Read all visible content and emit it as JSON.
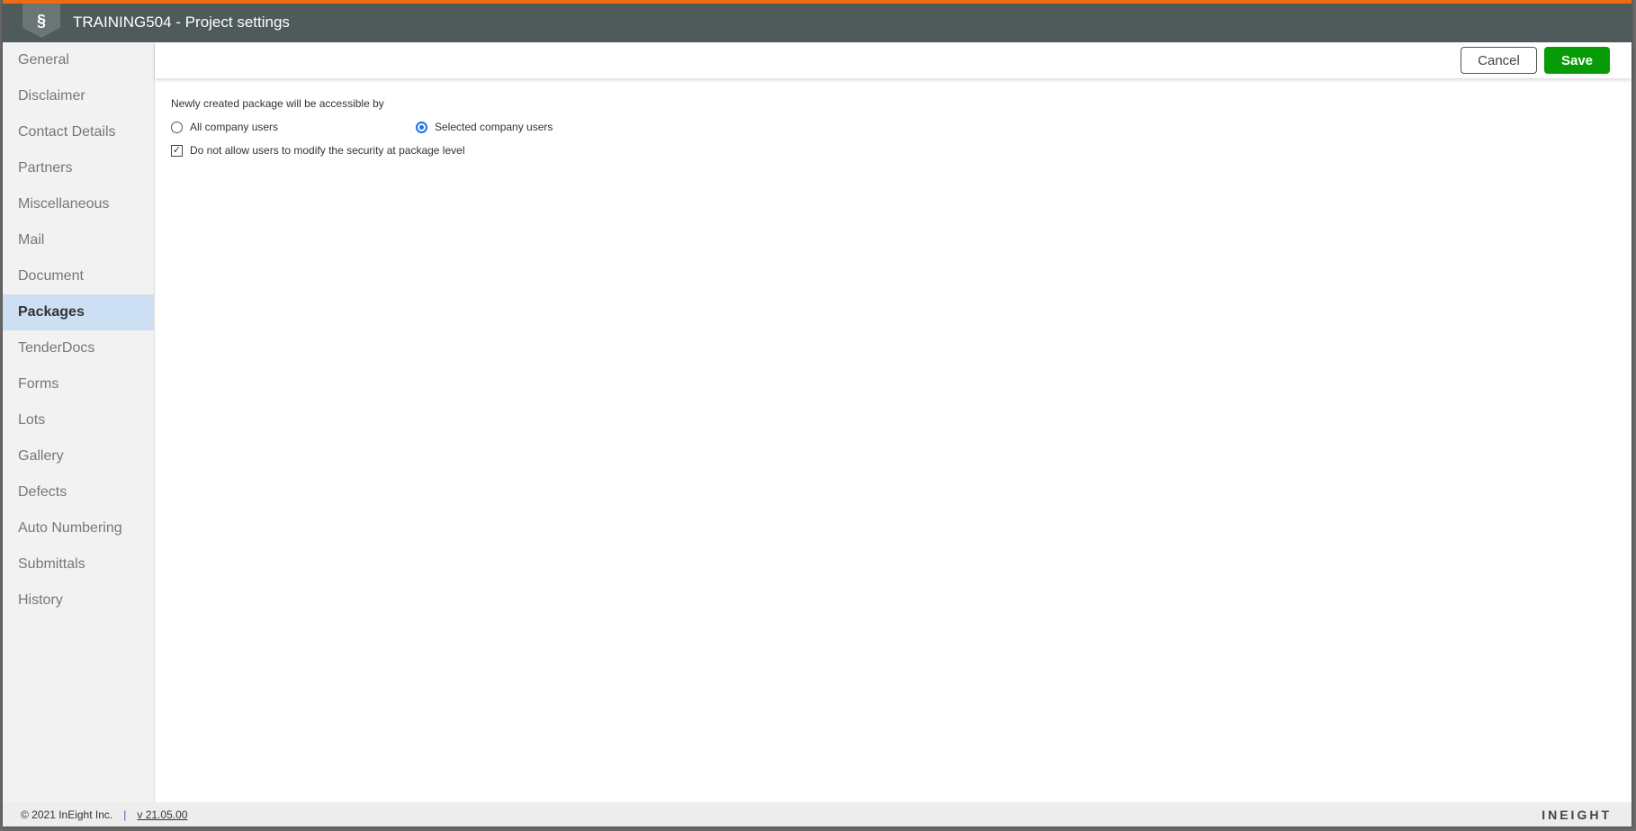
{
  "header": {
    "title": "TRAINING504 - Project settings",
    "logo_icon": "ineight-shield-logo"
  },
  "sidebar": {
    "items": [
      {
        "label": "General"
      },
      {
        "label": "Disclaimer"
      },
      {
        "label": "Contact Details"
      },
      {
        "label": "Partners"
      },
      {
        "label": "Miscellaneous"
      },
      {
        "label": "Mail"
      },
      {
        "label": "Document"
      },
      {
        "label": "Packages",
        "active": true
      },
      {
        "label": "TenderDocs"
      },
      {
        "label": "Forms"
      },
      {
        "label": "Lots"
      },
      {
        "label": "Gallery"
      },
      {
        "label": "Defects"
      },
      {
        "label": "Auto Numbering"
      },
      {
        "label": "Submittals"
      },
      {
        "label": "History"
      }
    ]
  },
  "toolbar": {
    "cancel_label": "Cancel",
    "save_label": "Save"
  },
  "content": {
    "heading": "Newly created package will be accessible by",
    "option_all": "All company users",
    "option_selected": "Selected company users",
    "selected": "Selected company users",
    "checkbox_label": "Do not allow users to modify the security at package level",
    "checkbox_checked": true
  },
  "footer": {
    "copyright": "© 2021 InEight Inc.",
    "separator": "|",
    "version": "v 21.05.00",
    "brand": "INEIGHT"
  },
  "colors": {
    "accent": "#f06a12",
    "header": "#4f5a5b",
    "save": "#079c07",
    "active_nav": "#cde0f3"
  }
}
